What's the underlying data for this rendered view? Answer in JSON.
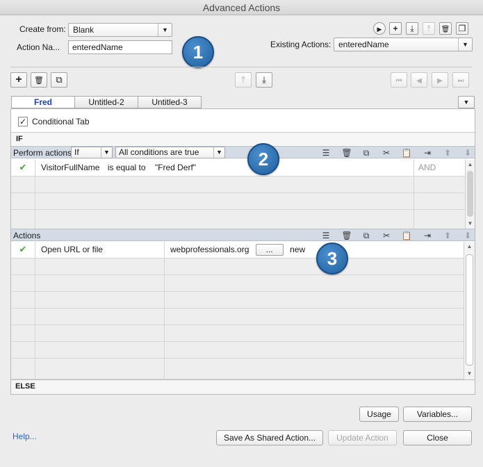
{
  "window": {
    "title": "Advanced Actions"
  },
  "top": {
    "create_from_label": "Create from:",
    "create_from_value": "Blank",
    "action_name_label": "Action Na...",
    "action_name_value": "enteredName",
    "existing_actions_label": "Existing Actions:",
    "existing_actions_value": "enteredName"
  },
  "badges": [
    "1",
    "2",
    "3"
  ],
  "tabs": [
    {
      "label": "Fred",
      "active": true
    },
    {
      "label": "Untitled-2",
      "active": false
    },
    {
      "label": "Untitled-3",
      "active": false
    }
  ],
  "conditional_tab": {
    "label": "Conditional Tab",
    "checked": true
  },
  "if_label": "IF",
  "perform": {
    "label": "Perform actions:",
    "type_value": "If",
    "condition_value": "All conditions are true"
  },
  "conditions": [
    {
      "variable": "VisitorFullName",
      "operator": "is equal to",
      "value": "\"Fred Derf\"",
      "join": "AND",
      "checked": true
    }
  ],
  "actions_label": "Actions",
  "actions": [
    {
      "action": "Open URL or file",
      "target": "webprofessionals.org",
      "more": "...",
      "window": "new",
      "checked": true
    }
  ],
  "else_label": "ELSE",
  "buttons": {
    "usage": "Usage",
    "variables": "Variables...",
    "help": "Help...",
    "save_shared": "Save As Shared Action...",
    "update": "Update Action",
    "close": "Close"
  },
  "glyphs": {
    "check": "✔",
    "checkbox": "✓",
    "arrow_down": "▼",
    "arrow_up": "▲",
    "play": "▶",
    "plus": "+",
    "trash": "🗑",
    "copy": "⧉",
    "cut": "✂",
    "paste": "📋",
    "insert": "⇥",
    "up": "⬆",
    "down": "⬇",
    "first": "⏮",
    "prev": "◀",
    "next": "▶",
    "last": "⏭",
    "import": "⤓",
    "export": "⤒",
    "windows": "❐",
    "add_row": "☰"
  }
}
